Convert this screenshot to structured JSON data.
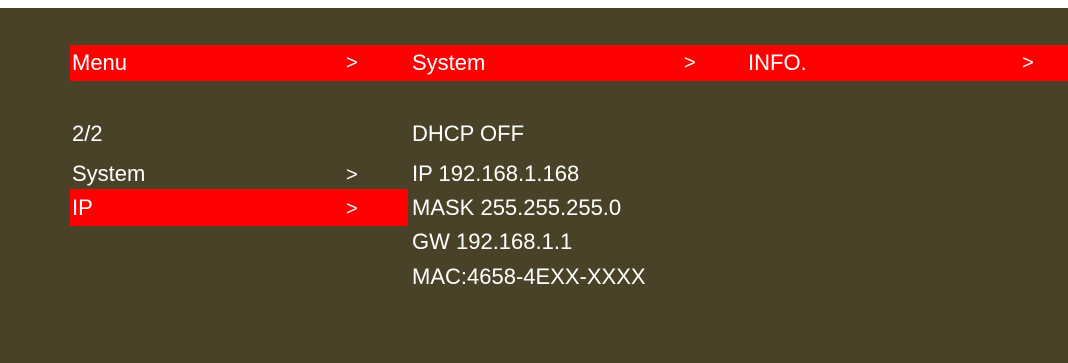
{
  "colors": {
    "background": "#4a4228",
    "highlight": "#ff0000",
    "text": "#ffffff"
  },
  "breadcrumb": {
    "items": [
      {
        "label": "Menu",
        "arrow": ">"
      },
      {
        "label": "System",
        "arrow": ">"
      },
      {
        "label": "INFO.",
        "arrow": ">"
      }
    ]
  },
  "left_menu": {
    "page_indicator": "2/2",
    "items": [
      {
        "label": "System",
        "arrow": ">",
        "selected": false
      },
      {
        "label": "IP",
        "arrow": ">",
        "selected": true
      }
    ]
  },
  "info_panel": {
    "lines": [
      "DHCP OFF",
      "IP 192.168.1.168",
      "MASK 255.255.255.0",
      "GW 192.168.1.1",
      "MAC:4658-4EXX-XXXX"
    ]
  }
}
